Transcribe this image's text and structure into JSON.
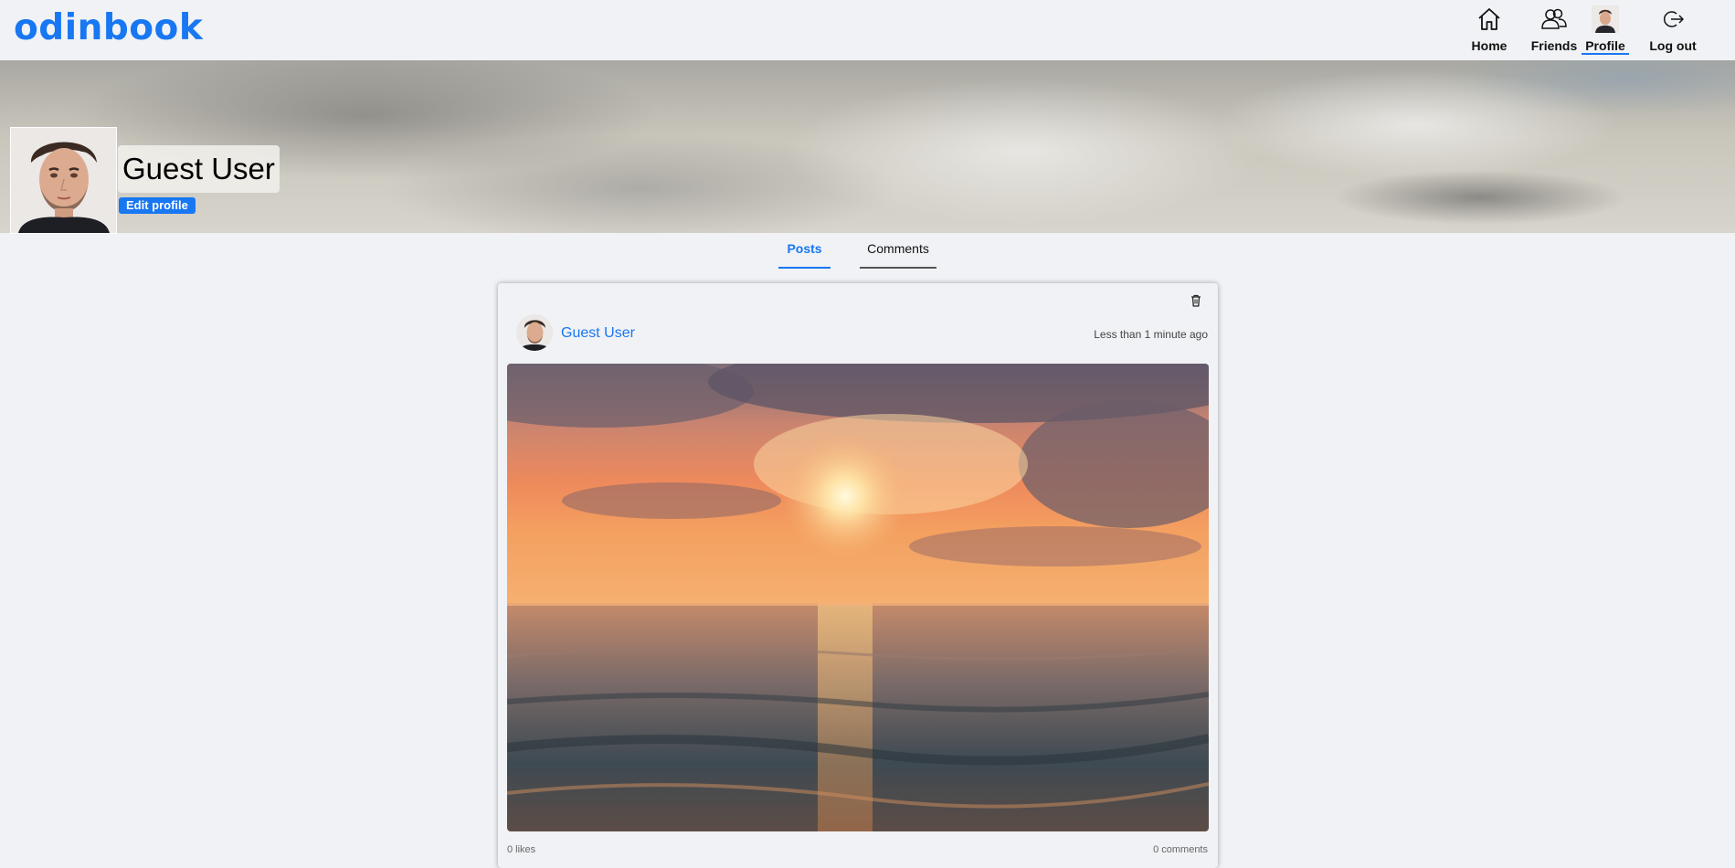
{
  "header": {
    "logo": "odinbook",
    "nav": [
      {
        "label": "Home",
        "icon": "home-icon"
      },
      {
        "label": "Friends",
        "icon": "friends-icon"
      },
      {
        "label": "Profile",
        "icon": "avatar"
      },
      {
        "label": "Log out",
        "icon": "logout-icon"
      }
    ],
    "active": "Profile"
  },
  "profile": {
    "name": "Guest User",
    "edit_label": "Edit profile"
  },
  "tabs": {
    "posts": "Posts",
    "comments": "Comments",
    "active": "Posts"
  },
  "post": {
    "author": "Guest User",
    "time": "Less than 1 minute ago",
    "likes": "0 likes",
    "comments": "0 comments"
  },
  "colors": {
    "accent": "#1877f2",
    "background": "#f0f2f5"
  }
}
